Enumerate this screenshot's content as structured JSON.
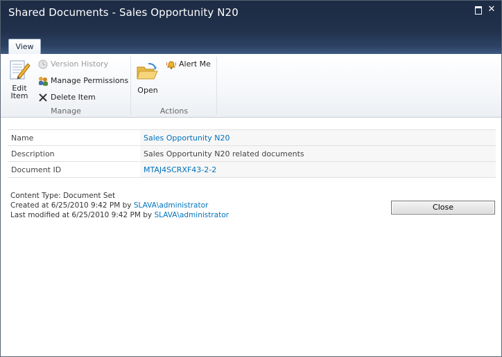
{
  "window": {
    "title": "Shared Documents - Sales Opportunity N20"
  },
  "ribbon": {
    "tabs": [
      {
        "label": "View"
      }
    ],
    "groups": {
      "manage": {
        "label": "Manage",
        "edit_item": {
          "line1": "Edit",
          "line2": "Item"
        },
        "version_history": "Version History",
        "manage_permissions": "Manage Permissions",
        "delete_item": "Delete Item"
      },
      "actions": {
        "label": "Actions",
        "open": "Open",
        "alert_me": "Alert Me"
      }
    }
  },
  "properties": [
    {
      "label": "Name",
      "value": "Sales Opportunity N20",
      "is_link": true
    },
    {
      "label": "Description",
      "value": "Sales Opportunity N20 related documents",
      "is_link": false
    },
    {
      "label": "Document ID",
      "value": "MTAJ4SCRXF43-2-2",
      "is_link": true
    }
  ],
  "meta": {
    "content_type": "Content Type: Document Set",
    "created_prefix": "Created at 6/25/2010 9:42 PM  by",
    "created_by": "SLAVA\\administrator",
    "modified_prefix": "Last modified at 6/25/2010 9:42 PM  by",
    "modified_by": "SLAVA\\administrator"
  },
  "buttons": {
    "close": "Close"
  },
  "colors": {
    "link": "#0072bc",
    "title_bar": "#21304b"
  }
}
